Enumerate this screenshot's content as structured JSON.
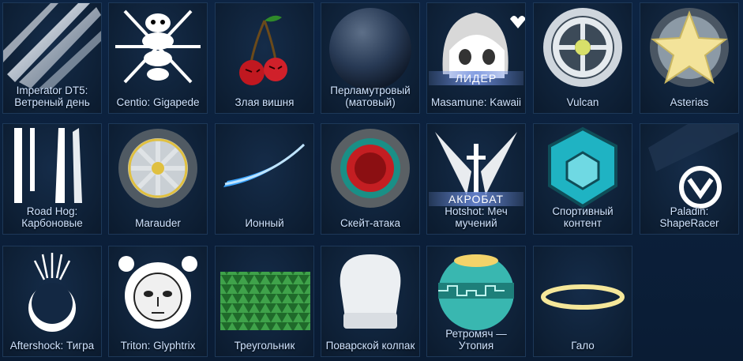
{
  "items": [
    {
      "label": "Imperator DT5: Ветреный день",
      "icon": "windy-stripes-decal-icon"
    },
    {
      "label": "Centio: Gigapede",
      "icon": "centipede-decal-icon"
    },
    {
      "label": "Злая вишня",
      "icon": "angry-cherry-topper-icon"
    },
    {
      "label": "Перламутровый (матовый)",
      "icon": "pearl-matte-paint-ball-icon"
    },
    {
      "label": "Masamune: Kawaii",
      "icon": "kawaii-anime-decal-icon",
      "badge": "ЛИДЕР"
    },
    {
      "label": "Vulcan",
      "icon": "vulcan-wheel-icon"
    },
    {
      "label": "Asterias",
      "icon": "star-wheel-icon"
    },
    {
      "label": "Road Hog: Карбоновые",
      "icon": "carbon-stripes-decal-icon"
    },
    {
      "label": "Marauder",
      "icon": "marauder-wheel-icon"
    },
    {
      "label": "Ионный",
      "icon": "ion-boost-trail-icon"
    },
    {
      "label": "Скейт-атака",
      "icon": "skate-attack-wheel-icon"
    },
    {
      "label": "Hotshot: Меч мучений",
      "icon": "sword-wings-decal-icon",
      "badge": "АКРОБАТ"
    },
    {
      "label": "Спортивный контент",
      "icon": "sport-ball-icon"
    },
    {
      "label": "Paladin: ShapeRacer",
      "icon": "shaperacer-decal-icon"
    },
    {
      "label": "Aftershock: Тигра",
      "icon": "crescent-decal-icon"
    },
    {
      "label": "Triton: Glyphtrix",
      "icon": "glyph-face-decal-icon"
    },
    {
      "label": "Треугольник",
      "icon": "triangle-pattern-icon"
    },
    {
      "label": "Поварской колпак",
      "icon": "chef-hat-topper-icon"
    },
    {
      "label": "Ретромяч — Утопия",
      "icon": "retro-ball-icon"
    },
    {
      "label": "Гало",
      "icon": "halo-topper-icon"
    }
  ]
}
